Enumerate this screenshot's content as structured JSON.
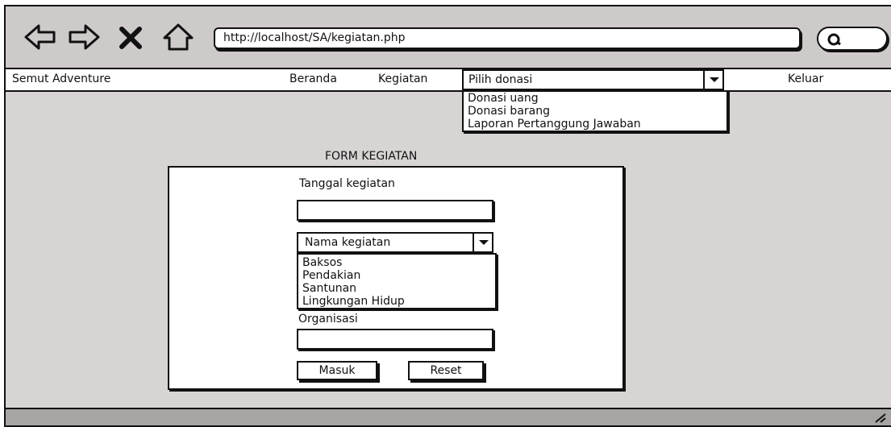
{
  "browser": {
    "url": "http://localhost/SA/kegiatan.php",
    "icons": [
      "back-arrow-icon",
      "forward-arrow-icon",
      "stop-icon",
      "home-icon",
      "search-icon"
    ]
  },
  "menubar": {
    "brand": "Semut Adventure",
    "home": "Beranda",
    "activity": "Kegiatan",
    "donation_select": "Pilih donasi",
    "logout": "Keluar",
    "donation_options": [
      "Donasi uang",
      "Donasi barang",
      "Laporan Pertanggung Jawaban"
    ]
  },
  "form": {
    "title": "FORM KEGIATAN",
    "date_label": "Tanggal kegiatan",
    "date_value": "",
    "name_select": "Nama kegiatan",
    "name_options": [
      "Baksos",
      "Pendakian",
      "Santunan",
      "Lingkungan Hidup"
    ],
    "org_label": "Organisasi",
    "org_value": "",
    "submit": "Masuk",
    "reset": "Reset"
  }
}
